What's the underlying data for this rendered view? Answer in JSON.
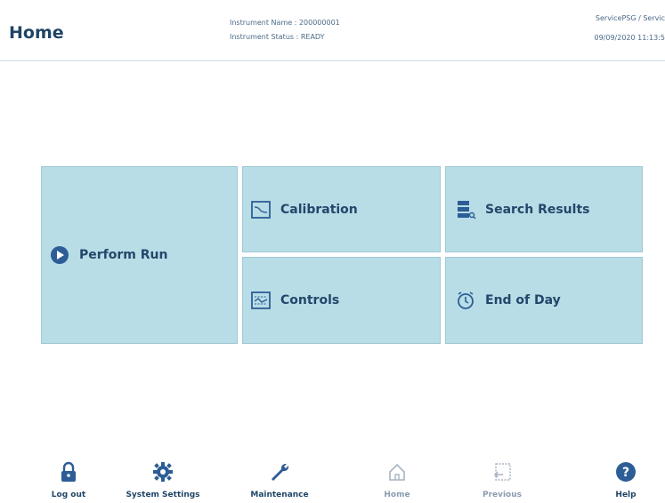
{
  "header": {
    "title": "Home",
    "instrument_name_label": "Instrument Name : 200000001",
    "instrument_status_label": "Instrument Status : READY",
    "user": "ServicePSG / Servic",
    "datetime": "09/09/2020 11:13:5"
  },
  "tiles": {
    "perform_run": "Perform Run",
    "calibration": "Calibration",
    "search_results": "Search Results",
    "controls": "Controls",
    "end_of_day": "End of Day"
  },
  "footer": {
    "logout": "Log out",
    "system_settings": "System Settings",
    "maintenance": "Maintenance",
    "home": "Home",
    "previous": "Previous",
    "help": "Help"
  },
  "colors": {
    "tile_bg": "#b8dde6",
    "accent": "#1f4566"
  }
}
